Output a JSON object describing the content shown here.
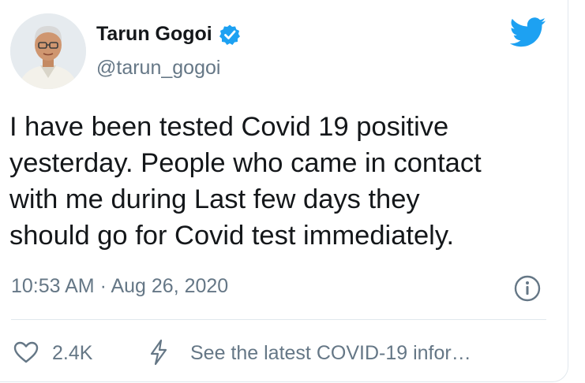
{
  "author": {
    "name": "Tarun Gogoi",
    "handle": "@tarun_gogoi",
    "verified": true
  },
  "tweet": {
    "text_lines": [
      "I have been tested Covid 19 positive",
      "yesterday. People who came in contact",
      "with me during Last few days they",
      "should go for Covid test immediately."
    ],
    "timestamp": "10:53 AM · Aug 26, 2020"
  },
  "actions": {
    "like_count": "2.4K",
    "covid_notice": "See the latest COVID-19 infor…"
  },
  "icons": {
    "brand": "twitter-bird-icon",
    "verified": "verified-badge-icon",
    "info": "info-icon",
    "like": "heart-icon",
    "notice": "lightning-bolt-icon"
  },
  "colors": {
    "brand_blue": "#1da1f2",
    "text": "#14171a",
    "secondary_text": "#657786",
    "divider": "#e1e8ed"
  }
}
